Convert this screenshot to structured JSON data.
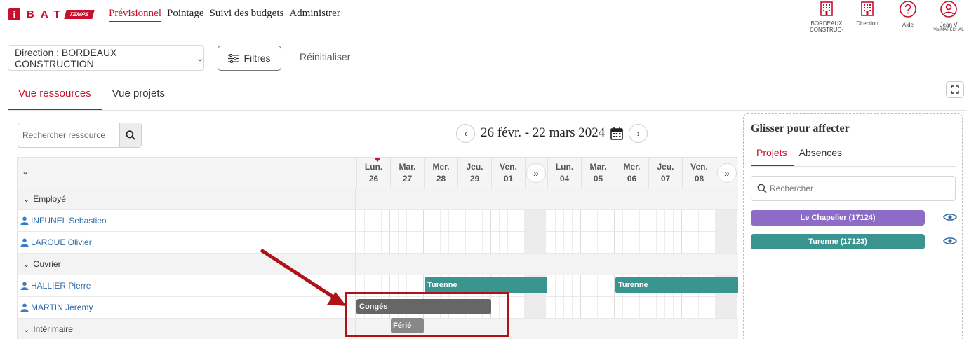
{
  "header": {
    "logo_i": "i",
    "logo_bat": "BAT",
    "logo_temps": "TEMPS",
    "nav": [
      "Prévisionnel",
      "Pointage",
      "Suivi des budgets",
      "Administrer"
    ],
    "icons": [
      {
        "icon": "building-icon",
        "label1": "BORDEAUX",
        "label2": "CONSTRUC-"
      },
      {
        "icon": "building-icon",
        "label1": "Direction",
        "label2": ""
      },
      {
        "icon": "help-icon",
        "label1": "Aide",
        "label2": ""
      },
      {
        "icon": "user-icon",
        "label1": "Jean V",
        "label2": "Vis MARECHAL"
      }
    ],
    "accent": "#c8102e"
  },
  "filters": {
    "direction": "Direction : BORDEAUX CONSTRUCTION",
    "filtres": "Filtres",
    "reset": "Réinitialiser"
  },
  "tabs": [
    "Vue ressources",
    "Vue projets"
  ],
  "planning": {
    "search_placeholder": "Rechercher ressource",
    "date_range": "26 févr. - 22 mars 2024",
    "days": [
      {
        "d": "Lun.",
        "n": "26"
      },
      {
        "d": "Mar.",
        "n": "27"
      },
      {
        "d": "Mer.",
        "n": "28"
      },
      {
        "d": "Jeu.",
        "n": "29"
      },
      {
        "d": "Ven.",
        "n": "01"
      },
      {
        "d": "Lun.",
        "n": "04"
      },
      {
        "d": "Mar.",
        "n": "05"
      },
      {
        "d": "Mer.",
        "n": "06"
      },
      {
        "d": "Jeu.",
        "n": "07"
      },
      {
        "d": "Ven.",
        "n": "08"
      }
    ],
    "rows": [
      {
        "type": "group",
        "label": "Employé"
      },
      {
        "type": "res",
        "label": "INFUNEL Sebastien"
      },
      {
        "type": "res",
        "label": "LAROUE Olivier"
      },
      {
        "type": "group",
        "label": "Ouvrier"
      },
      {
        "type": "res",
        "label": "HALLIER Pierre"
      },
      {
        "type": "res",
        "label": "MARTIN Jeremy"
      },
      {
        "type": "group",
        "label": "Intérimaire"
      }
    ],
    "bars": {
      "turenne_1": "Turenne",
      "turenne_2": "Turenne",
      "conges": "Congés",
      "ferie": "Férié"
    },
    "colors": {
      "turenne": "#3a9490",
      "conges": "#666666",
      "ferie": "#888888"
    }
  },
  "panel": {
    "title": "Glisser pour affecter",
    "tabs": [
      "Projets",
      "Absences"
    ],
    "search_placeholder": "Rechercher",
    "projects": [
      {
        "name": "Le Chapelier (17124)",
        "color": "#8d6cc8"
      },
      {
        "name": "Turenne (17123)",
        "color": "#3a9490"
      }
    ]
  }
}
